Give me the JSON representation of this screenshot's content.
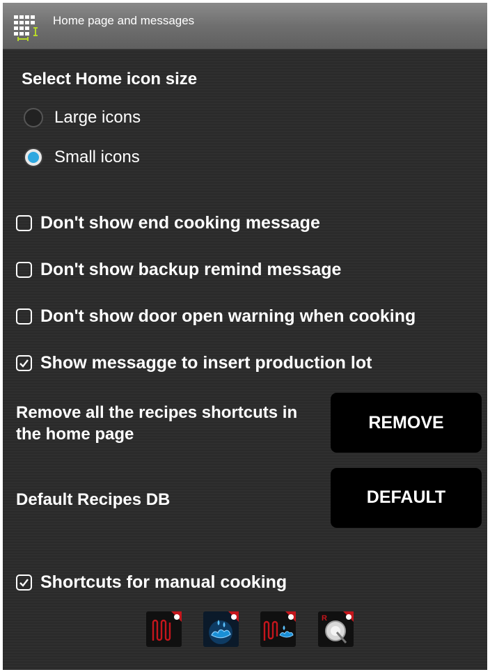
{
  "window": {
    "title": "Home page and messages"
  },
  "icon_size": {
    "heading": "Select Home icon size",
    "options": [
      {
        "label": "Large icons",
        "selected": false
      },
      {
        "label": "Small icons",
        "selected": true
      }
    ]
  },
  "messages": {
    "options": [
      {
        "label": "Don't show end cooking message",
        "checked": false
      },
      {
        "label": "Don't show backup remind message",
        "checked": false
      },
      {
        "label": "Don't show door open warning when cooking",
        "checked": false
      },
      {
        "label": "Show messagge to insert production lot",
        "checked": true
      }
    ]
  },
  "remove_shortcuts": {
    "label_line1": "Remove all the recipes shortcuts in",
    "label_line2": "the home page",
    "button": "REMOVE"
  },
  "default_db": {
    "label": "Default Recipes DB",
    "button": "DEFAULT"
  },
  "manual_shortcuts": {
    "label": "Shortcuts for manual cooking",
    "checked": true,
    "icons": [
      "convection-cooking-icon",
      "steam-cooking-icon",
      "combi-cooking-icon",
      "regeneration-probe-icon"
    ]
  },
  "colors": {
    "radio_selected": "#2fa8e0",
    "background": "#2b2b2b",
    "button_bg": "#000000",
    "shortcut_red": "#c4161c",
    "shortcut_blue": "#1a8fd6"
  }
}
